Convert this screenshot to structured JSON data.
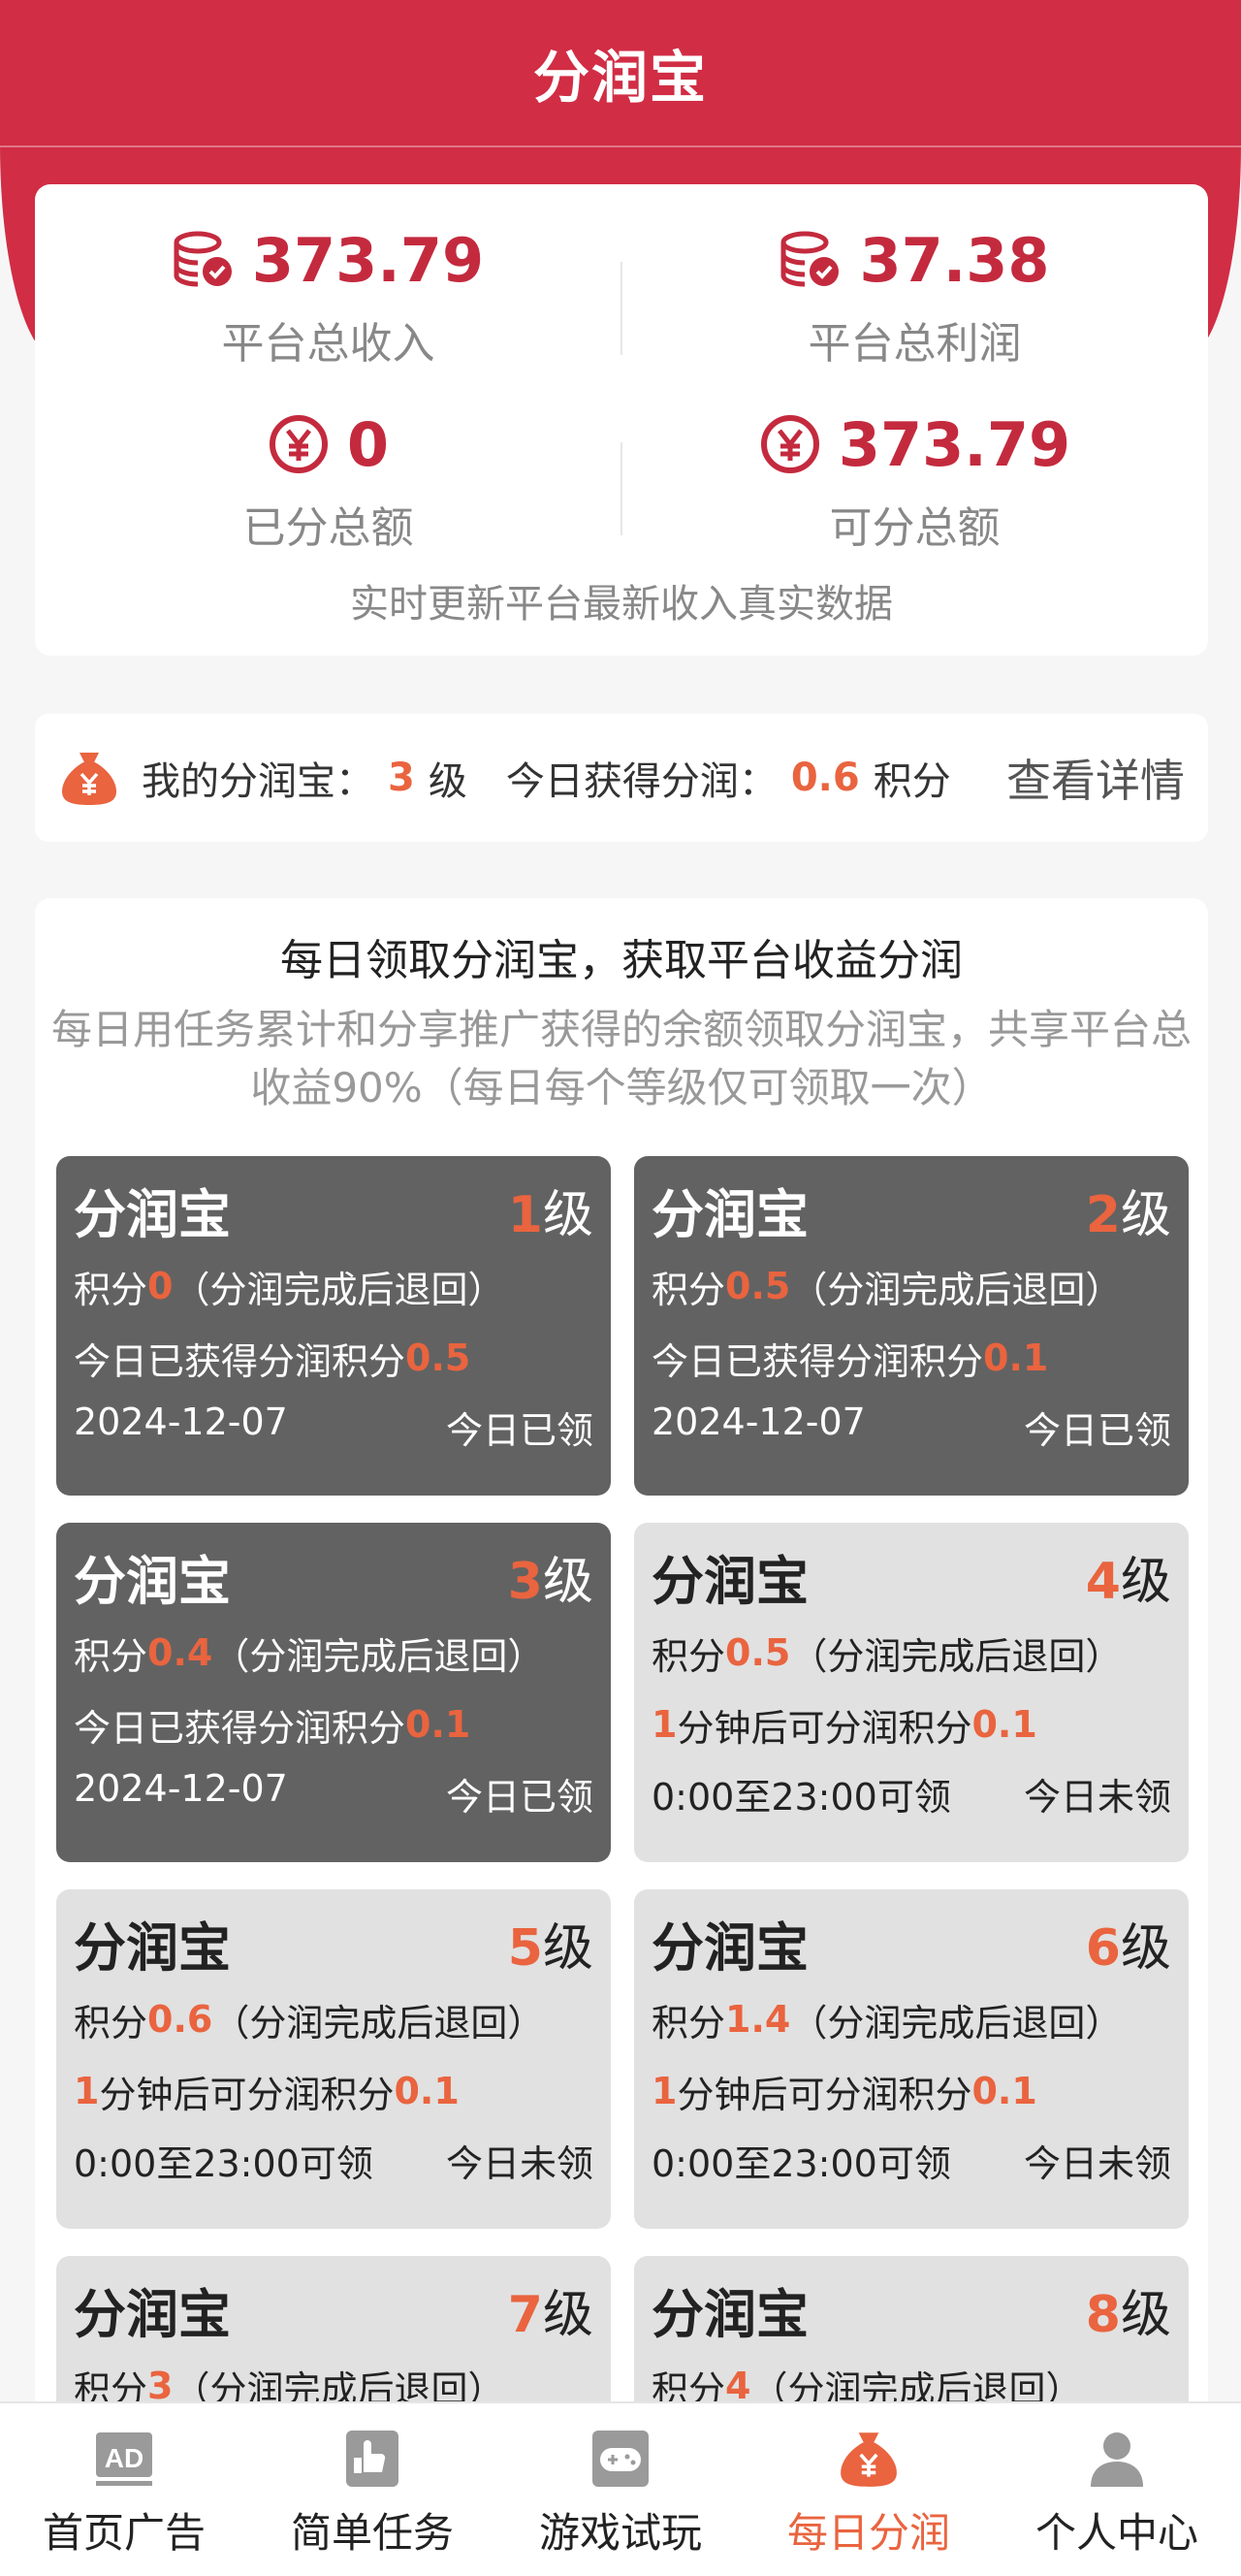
{
  "header": {
    "title": "分润宝"
  },
  "stats": {
    "total_income": {
      "value": "373.79",
      "label": "平台总收入"
    },
    "total_profit": {
      "value": "37.38",
      "label": "平台总利润"
    },
    "distributed": {
      "value": "0",
      "label": "已分总额"
    },
    "distributable": {
      "value": "373.79",
      "label": "可分总额"
    },
    "note": "实时更新平台最新收入真实数据"
  },
  "mine": {
    "label": "我的分润宝：",
    "level": "3",
    "level_unit": "级",
    "today_label": "今日获得分润：",
    "today_value": "0.6",
    "today_unit": "积分",
    "detail": "查看详情"
  },
  "main": {
    "title": "每日领取分润宝，获取平台收益分润",
    "desc": "每日用任务累计和分享推广获得的余额领取分润宝，共享平台总收益90%（每日每个等级仅可领取一次）"
  },
  "cards": [
    {
      "name": "分润宝",
      "level": "1",
      "level_unit": "级",
      "points_prefix": "积分",
      "points": "0",
      "points_suffix": "（分润完成后退回）",
      "line2_prefix": "今日已获得分润积分",
      "line2_value": "0.5",
      "line2_mid": "",
      "line2_value2": "",
      "date": "2024-12-07",
      "status": "今日已领"
    },
    {
      "name": "分润宝",
      "level": "2",
      "level_unit": "级",
      "points_prefix": "积分",
      "points": "0.5",
      "points_suffix": "（分润完成后退回）",
      "line2_prefix": "今日已获得分润积分",
      "line2_value": "0.1",
      "line2_mid": "",
      "line2_value2": "",
      "date": "2024-12-07",
      "status": "今日已领"
    },
    {
      "name": "分润宝",
      "level": "3",
      "level_unit": "级",
      "points_prefix": "积分",
      "points": "0.4",
      "points_suffix": "（分润完成后退回）",
      "line2_prefix": "今日已获得分润积分",
      "line2_value": "0.1",
      "line2_mid": "",
      "line2_value2": "",
      "date": "2024-12-07",
      "status": "今日已领"
    },
    {
      "name": "分润宝",
      "level": "4",
      "level_unit": "级",
      "points_prefix": "积分",
      "points": "0.5",
      "points_suffix": "（分润完成后退回）",
      "line2_prefix": "",
      "line2_value": "1",
      "line2_mid": "分钟后可分润积分",
      "line2_value2": "0.1",
      "date": "0:00至23:00可领",
      "status": "今日未领"
    },
    {
      "name": "分润宝",
      "level": "5",
      "level_unit": "级",
      "points_prefix": "积分",
      "points": "0.6",
      "points_suffix": "（分润完成后退回）",
      "line2_prefix": "",
      "line2_value": "1",
      "line2_mid": "分钟后可分润积分",
      "line2_value2": "0.1",
      "date": "0:00至23:00可领",
      "status": "今日未领"
    },
    {
      "name": "分润宝",
      "level": "6",
      "level_unit": "级",
      "points_prefix": "积分",
      "points": "1.4",
      "points_suffix": "（分润完成后退回）",
      "line2_prefix": "",
      "line2_value": "1",
      "line2_mid": "分钟后可分润积分",
      "line2_value2": "0.1",
      "date": "0:00至23:00可领",
      "status": "今日未领"
    },
    {
      "name": "分润宝",
      "level": "7",
      "level_unit": "级",
      "points_prefix": "积分",
      "points": "3",
      "points_suffix": "（分润完成后退回）",
      "line2_prefix": "",
      "line2_value": "",
      "line2_mid": "",
      "line2_value2": "",
      "date": "",
      "status": ""
    },
    {
      "name": "分润宝",
      "level": "8",
      "level_unit": "级",
      "points_prefix": "积分",
      "points": "4",
      "points_suffix": "（分润完成后退回）",
      "line2_prefix": "",
      "line2_value": "",
      "line2_mid": "",
      "line2_value2": "",
      "date": "",
      "status": ""
    }
  ],
  "tabs": [
    {
      "label": "首页广告",
      "icon": "ad-icon"
    },
    {
      "label": "简单任务",
      "icon": "task-icon"
    },
    {
      "label": "游戏试玩",
      "icon": "gamepad-icon"
    },
    {
      "label": "每日分润",
      "icon": "money-bag-icon",
      "active": true
    },
    {
      "label": "个人中心",
      "icon": "user-icon"
    }
  ],
  "colors": {
    "brand": "#d12d45",
    "accent": "#e9643f",
    "claimed_card": "#626262",
    "unclaimed_card": "#e1e1e1"
  }
}
